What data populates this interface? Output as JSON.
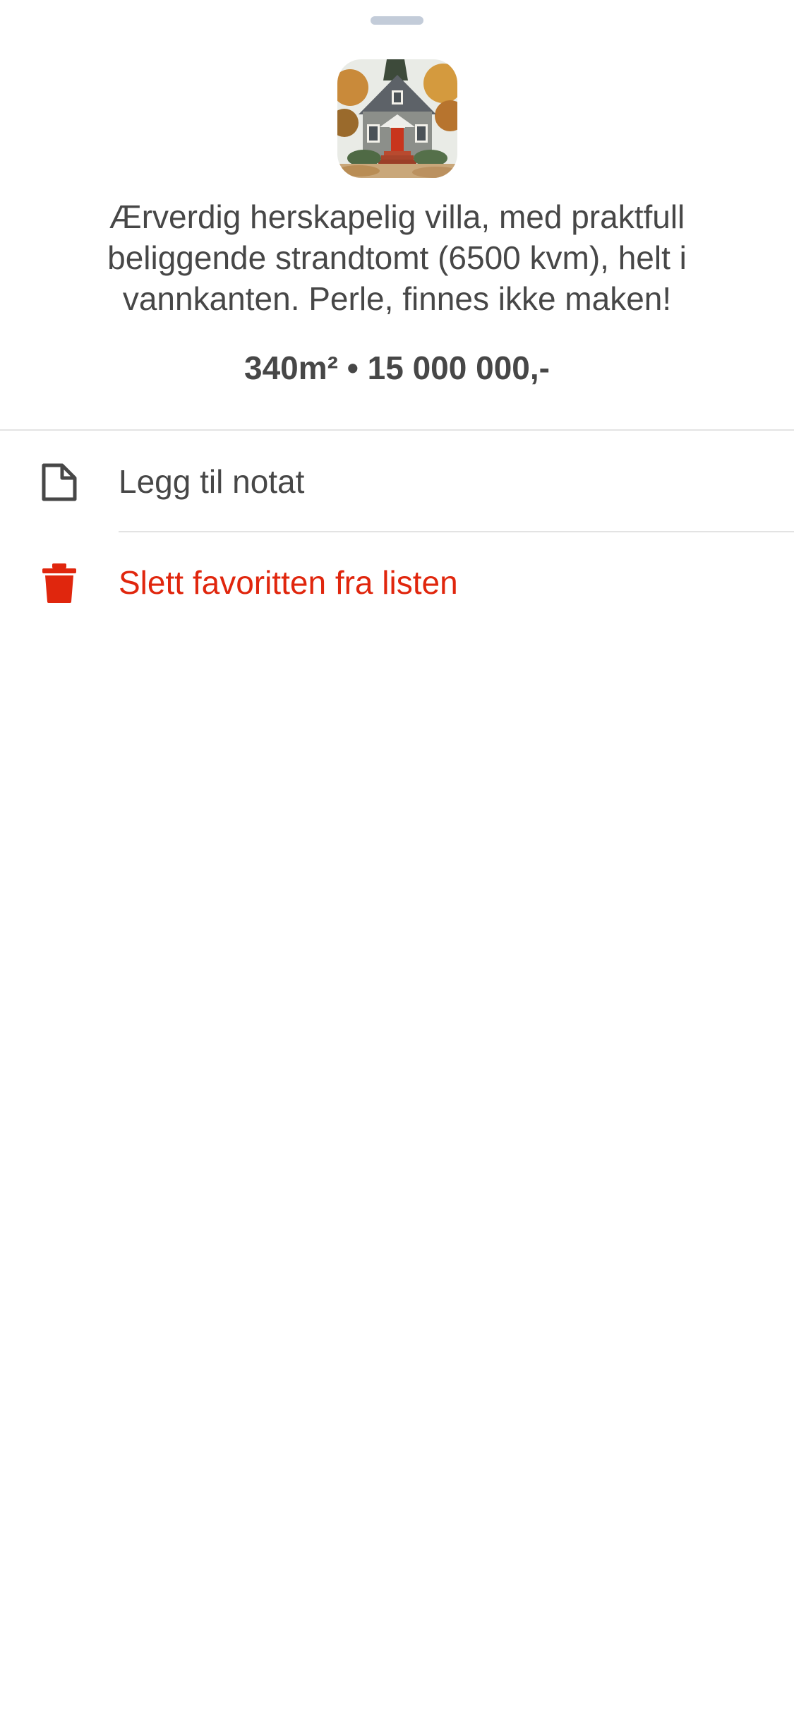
{
  "listing": {
    "description": "Ærverdig herskapelig villa, med praktfull beliggende strandtomt (6500 kvm), helt i vannkanten. Perle, finnes ikke maken!",
    "meta": "340m² • 15 000 000,-"
  },
  "actions": {
    "add_note": {
      "label": "Legg til notat",
      "icon": "note-icon"
    },
    "delete_favorite": {
      "label": "Slett favoritten fra listen",
      "icon": "trash-icon",
      "color": "#e0260d"
    }
  },
  "colors": {
    "text": "#474747",
    "danger": "#e0260d",
    "divider": "#e3e3e3",
    "grabber": "#c3ccd9"
  }
}
